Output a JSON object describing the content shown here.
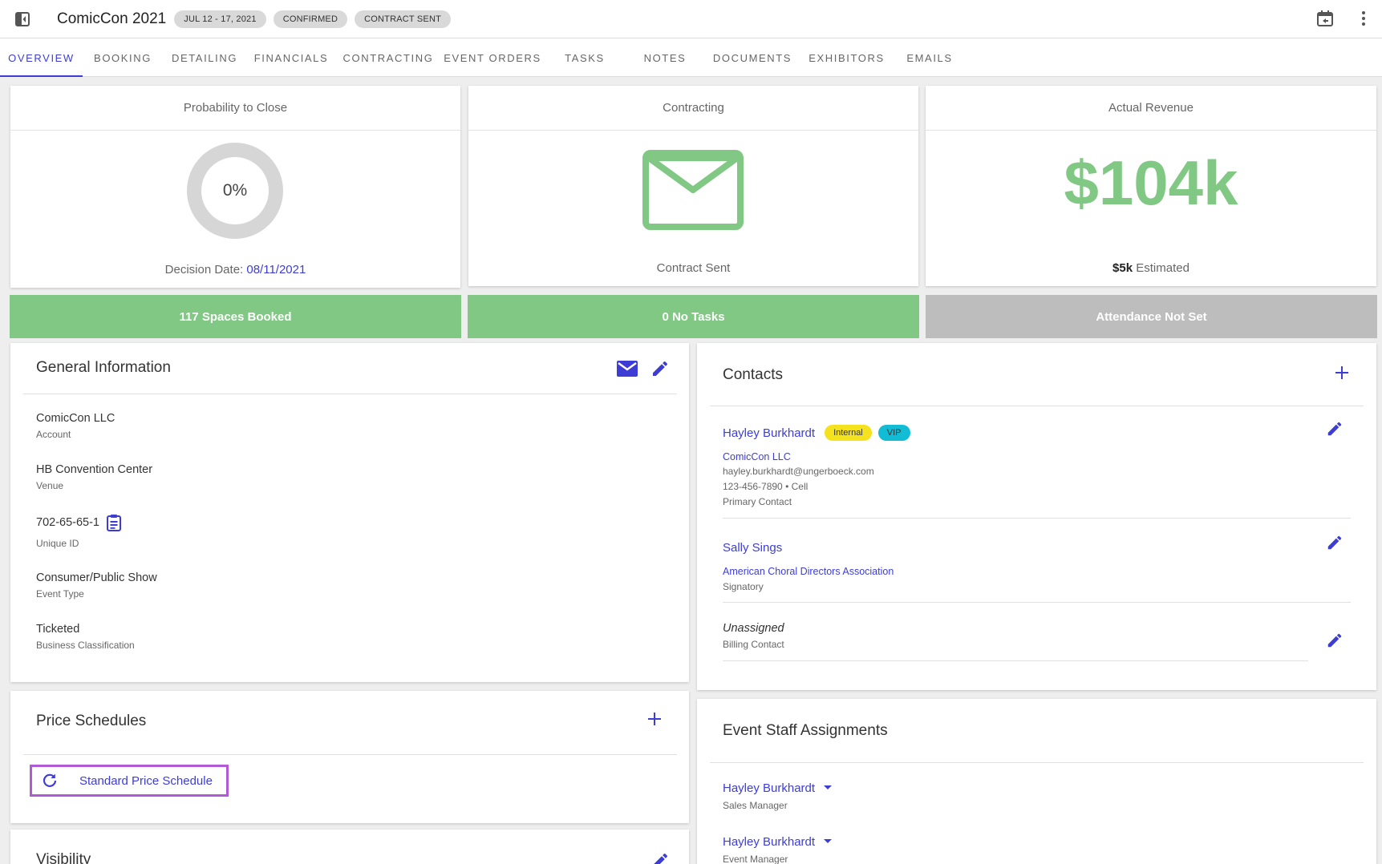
{
  "app": {
    "title": "ComicCon 2021",
    "chips": [
      "JUL 12 - 17, 2021",
      "CONFIRMED",
      "CONTRACT SENT"
    ]
  },
  "tabs": [
    {
      "label": "OVERVIEW",
      "active": true
    },
    {
      "label": "BOOKING"
    },
    {
      "label": "DETAILING"
    },
    {
      "label": "FINANCIALS"
    },
    {
      "label": "CONTRACTING"
    },
    {
      "label": "EVENT ORDERS"
    },
    {
      "label": "TASKS"
    },
    {
      "label": "NOTES"
    },
    {
      "label": "DOCUMENTS"
    },
    {
      "label": "EXHIBITORS"
    },
    {
      "label": "EMAILS"
    }
  ],
  "kpi": {
    "probability": {
      "title": "Probability to Close",
      "value": "0%",
      "decision_label": "Decision Date:",
      "decision_date": "08/11/2021"
    },
    "contracting": {
      "title": "Contracting",
      "status": "Contract Sent",
      "icon": "envelope-icon"
    },
    "revenue": {
      "title": "Actual Revenue",
      "value": "$104k",
      "estimated_value": "$5k",
      "estimated_label": "Estimated"
    }
  },
  "status_bars": {
    "spaces": "117 Spaces Booked",
    "tasks": "0 No Tasks",
    "attendance": "Attendance Not Set"
  },
  "general_info": {
    "title": "General Information",
    "account": {
      "value": "ComicCon LLC",
      "label": "Account"
    },
    "venue": {
      "value": "HB Convention Center",
      "label": "Venue"
    },
    "unique_id": {
      "value": "702-65-65-1",
      "label": "Unique ID"
    },
    "event_type": {
      "value": "Consumer/Public Show",
      "label": "Event Type"
    },
    "business_class": {
      "value": "Ticketed",
      "label": "Business Classification"
    }
  },
  "price_schedules": {
    "title": "Price Schedules",
    "items": [
      "Standard Price Schedule"
    ]
  },
  "visibility": {
    "title": "Visibility"
  },
  "contacts": {
    "title": "Contacts",
    "items": [
      {
        "name": "Hayley Burkhardt",
        "badges": [
          "Internal",
          "VIP"
        ],
        "company": "ComicCon LLC",
        "email": "hayley.burkhardt@ungerboeck.com",
        "phone": "123-456-7890 • Cell",
        "role": "Primary Contact"
      },
      {
        "name": "Sally Sings",
        "company": "American Choral Directors Association",
        "role": "Signatory"
      },
      {
        "name": "Unassigned",
        "role": "Billing Contact"
      }
    ]
  },
  "staff": {
    "title": "Event Staff Assignments",
    "items": [
      {
        "name": "Hayley Burkhardt",
        "role": "Sales Manager"
      },
      {
        "name": "Hayley Burkhardt",
        "role": "Event Manager"
      }
    ]
  },
  "colors": {
    "accent": "#3d3dd6",
    "success": "#80c883",
    "neutral": "#bdbdbd",
    "badge_internal": "#f4e21f",
    "badge_vip": "#12bcd4",
    "highlight": "#b05ad6"
  }
}
